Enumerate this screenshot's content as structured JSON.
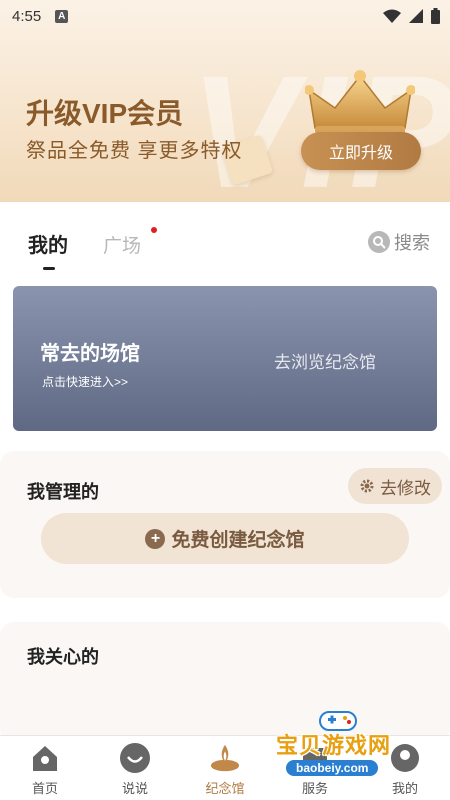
{
  "status": {
    "time": "4:55",
    "a_icon": "A"
  },
  "banner": {
    "watermark": "VIP",
    "title": "升级VIP会员",
    "subtitle": "祭品全免费 享更多特权",
    "button_label": "立即升级"
  },
  "tabs": {
    "mine": "我的",
    "square": "广场",
    "search": "搜索"
  },
  "venue_card": {
    "title": "常去的场馆",
    "subtitle": "点击快速进入>>",
    "browse": "去浏览纪念馆"
  },
  "manage": {
    "title": "我管理的",
    "edit_label": "去修改",
    "create_label": "免费创建纪念馆"
  },
  "care": {
    "title": "我关心的"
  },
  "nav": [
    {
      "label": "首页",
      "icon": "home-icon"
    },
    {
      "label": "说说",
      "icon": "chat-icon"
    },
    {
      "label": "纪念馆",
      "icon": "memorial-icon"
    },
    {
      "label": "服务",
      "icon": "service-icon"
    },
    {
      "label": "我的",
      "icon": "profile-icon"
    }
  ],
  "watermark": {
    "text": "宝贝游戏网",
    "url": "baobeiy.com"
  },
  "colors": {
    "accent": "#b07a42",
    "card": "#6f7894",
    "banner": "#f6e4cc"
  }
}
